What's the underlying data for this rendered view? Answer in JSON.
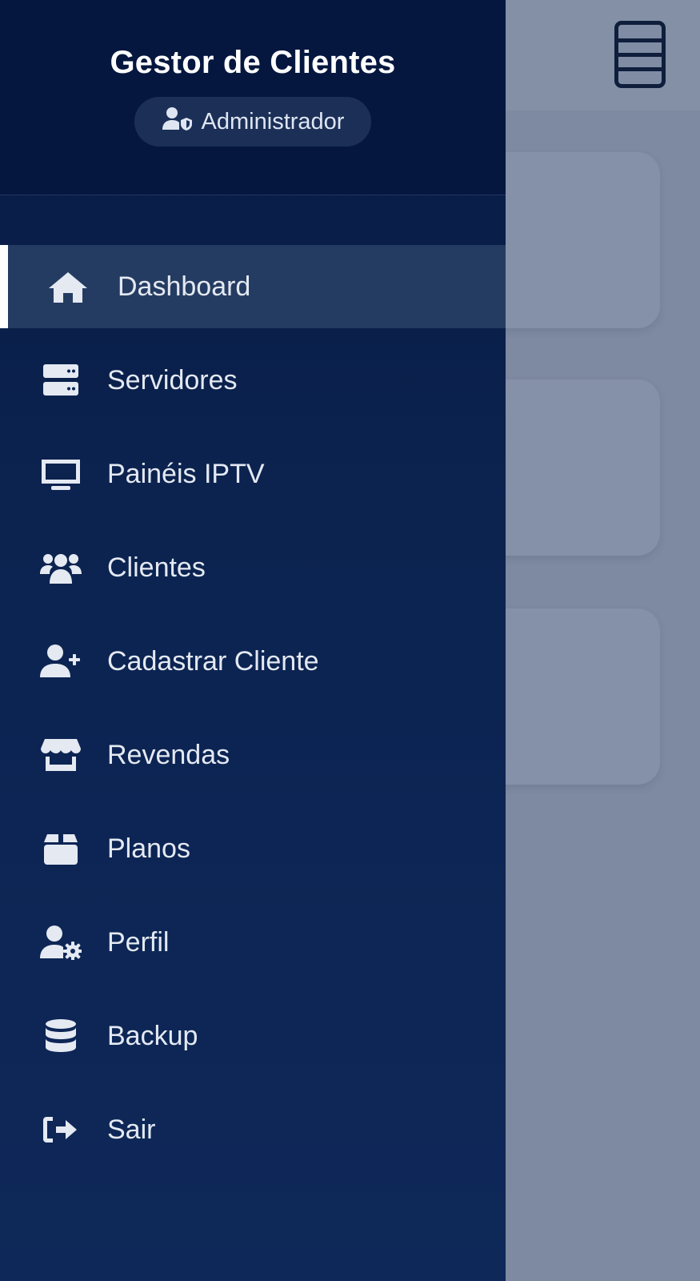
{
  "app": {
    "title": "Gestor de Clientes"
  },
  "user": {
    "role": "Administrador"
  },
  "nav": {
    "items": [
      {
        "label": "Dashboard",
        "icon": "home-icon",
        "active": true
      },
      {
        "label": "Servidores",
        "icon": "server-icon"
      },
      {
        "label": "Painéis IPTV",
        "icon": "monitor-icon"
      },
      {
        "label": "Clientes",
        "icon": "users-icon"
      },
      {
        "label": "Cadastrar Cliente",
        "icon": "user-plus-icon"
      },
      {
        "label": "Revendas",
        "icon": "store-icon"
      },
      {
        "label": "Planos",
        "icon": "box-icon"
      },
      {
        "label": "Perfil",
        "icon": "user-gear-icon"
      },
      {
        "label": "Backup",
        "icon": "database-icon"
      },
      {
        "label": "Sair",
        "icon": "logout-icon"
      }
    ]
  },
  "colors": {
    "sidebar_top": "#071a42",
    "sidebar_bottom": "#0e2859",
    "active_item": "#253c62",
    "overlay": "#7e8aa2"
  }
}
